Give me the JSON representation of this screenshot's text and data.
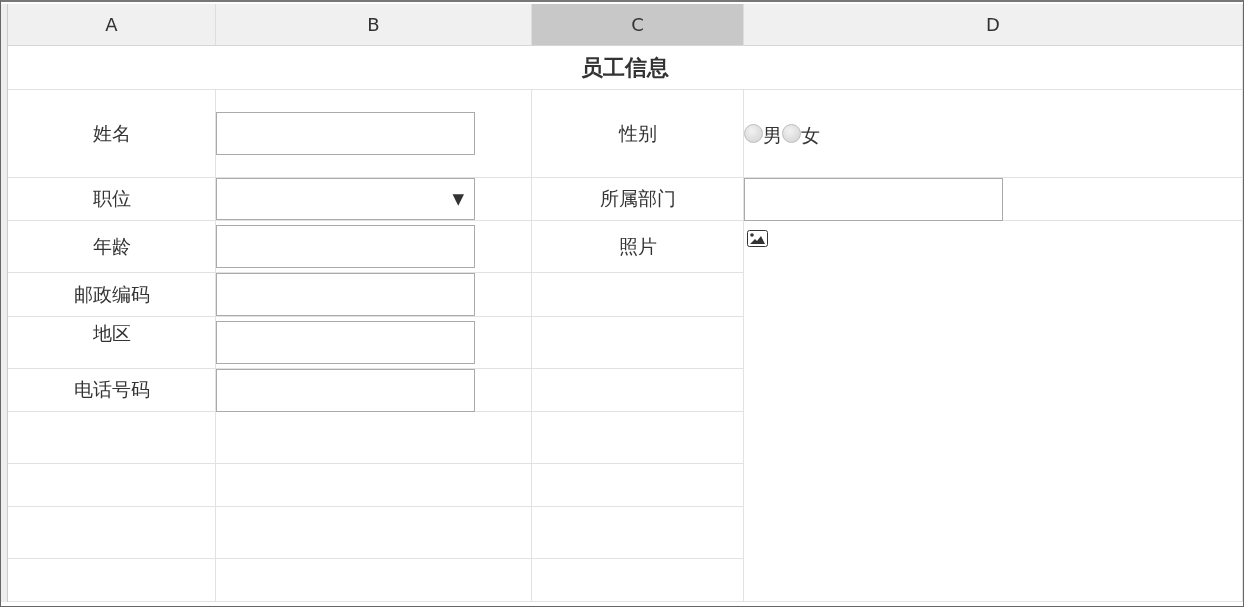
{
  "column_headers": [
    {
      "label": "A",
      "selected": false
    },
    {
      "label": "B",
      "selected": false
    },
    {
      "label": "C",
      "selected": true
    },
    {
      "label": "D",
      "selected": false
    }
  ],
  "title": "员工信息",
  "fields": [
    {
      "label": "姓名",
      "kind": "text"
    },
    {
      "label": "性别",
      "kind": "radio",
      "options": [
        {
          "label": "男",
          "selected": false
        },
        {
          "label": "女",
          "selected": false
        }
      ]
    },
    {
      "label": "职位",
      "kind": "select",
      "caret": "▼"
    },
    {
      "label": "所属部门",
      "kind": "text"
    },
    {
      "label": "年龄",
      "kind": "text"
    },
    {
      "label": "照片",
      "kind": "image"
    },
    {
      "label": "邮政编码",
      "kind": "text"
    },
    {
      "label": "地区",
      "kind": "text"
    },
    {
      "label": "电话号码",
      "kind": "text"
    }
  ]
}
